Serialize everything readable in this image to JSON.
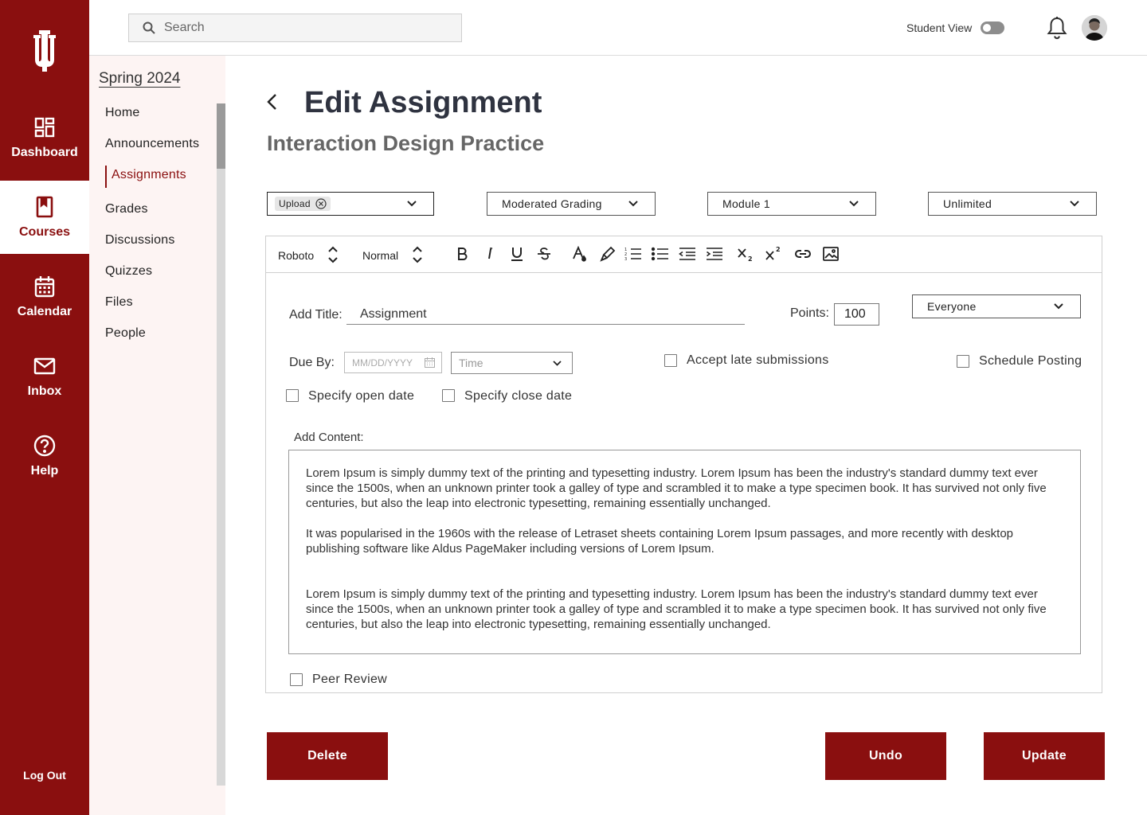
{
  "brand": {
    "accent": "#8a0f0f",
    "nav_bg": "#fdf4f3",
    "logo_icon": "trident-logo"
  },
  "rail": {
    "items": [
      {
        "label": "Dashboard",
        "icon": "dashboard-icon"
      },
      {
        "label": "Courses",
        "icon": "book-icon"
      },
      {
        "label": "Calendar",
        "icon": "calendar-icon"
      },
      {
        "label": "Inbox",
        "icon": "mail-icon"
      },
      {
        "label": "Help",
        "icon": "help-icon"
      }
    ],
    "active": "Courses",
    "logout": "Log Out"
  },
  "header": {
    "search_placeholder": "Search",
    "student_view_label": "Student View",
    "student_view_on": false
  },
  "course_nav": {
    "term": "Spring 2024",
    "items": [
      "Home",
      "Announcements",
      "Assignments",
      "Grades",
      "Discussions",
      "Quizzes",
      "Files",
      "People"
    ],
    "active": "Assignments"
  },
  "page": {
    "title": "Edit Assignment",
    "subtitle": "Interaction Design Practice"
  },
  "selects": {
    "submission_tag": "Upload",
    "grading": "Moderated Grading",
    "module": "Module 1",
    "attempts": "Unlimited"
  },
  "toolbar": {
    "font": "Roboto",
    "style": "Normal",
    "buttons": [
      "bold-icon",
      "italic-icon",
      "underline-icon",
      "strikethrough-icon",
      "text-color-icon",
      "highlight-icon",
      "numbered-list-icon",
      "bullet-list-icon",
      "outdent-icon",
      "indent-icon",
      "subscript-icon",
      "superscript-icon",
      "link-icon",
      "image-icon"
    ]
  },
  "form": {
    "title_label": "Add Title:",
    "title_value": "Assignment",
    "points_label": "Points:",
    "points_value": "100",
    "audience": "Everyone",
    "due_label": "Due By:",
    "date_placeholder": "MM/DD/YYYY",
    "time_placeholder": "Time",
    "accept_late_label": "Accept late submissions",
    "schedule_label": "Schedule Posting",
    "open_date_label": "Specify open date",
    "close_date_label": "Specify close date",
    "content_label": "Add Content:",
    "content": [
      "Lorem Ipsum is simply dummy text of the printing and typesetting industry. Lorem Ipsum has been the industry's standard dummy text ever since the 1500s, when an unknown printer took a galley of type and scrambled it to make a type specimen book. It has survived not only five centuries, but also the leap into electronic typesetting, remaining essentially unchanged.",
      "It was popularised in the 1960s with the release of Letraset sheets containing Lorem Ipsum passages, and more recently with desktop publishing software like Aldus PageMaker including versions of Lorem Ipsum.",
      "Lorem Ipsum is simply dummy text of the printing and typesetting industry. Lorem Ipsum has been the industry's standard dummy text ever since the 1500s, when an unknown printer took a galley of type and scrambled it to make a type specimen book. It has survived not only five centuries, but also the leap into electronic typesetting, remaining essentially unchanged."
    ],
    "peer_review_label": "Peer Review"
  },
  "actions": {
    "delete": "Delete",
    "undo": "Undo",
    "update": "Update"
  }
}
